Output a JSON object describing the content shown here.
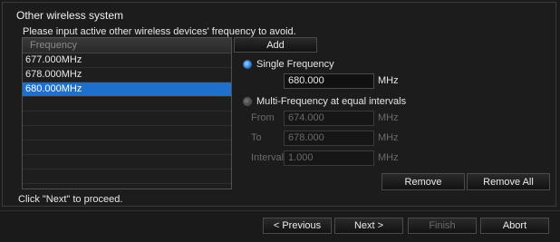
{
  "panel": {
    "title": "Other wireless system",
    "instruction": "Please input active other wireless devices' frequency  to avoid."
  },
  "frequency_list": {
    "header": "Frequency",
    "items": [
      "677.000MHz",
      "678.000MHz",
      "680.000MHz"
    ],
    "selected_item": "680.000MHz"
  },
  "add_button": "Add",
  "single_frequency": {
    "label": "Single Frequency",
    "selected": true,
    "value": "680.000",
    "unit": "MHz"
  },
  "multi_frequency": {
    "label": "Multi-Frequency at equal intervals",
    "selected": false,
    "from_label": "From",
    "from_value": "674.000",
    "to_label": "To",
    "to_value": "678.000",
    "interval_label": "Interval",
    "interval_value": "1.000",
    "unit": "MHz"
  },
  "remove_button": "Remove",
  "remove_all_button": "Remove All",
  "proceed_hint": "Click \"Next\" to proceed.",
  "nav": {
    "previous": "< Previous",
    "next": "Next >",
    "finish": "Finish",
    "abort": "Abort"
  },
  "colors": {
    "selection": "#1f6fcc",
    "radio_on": "#3d8fe0"
  }
}
